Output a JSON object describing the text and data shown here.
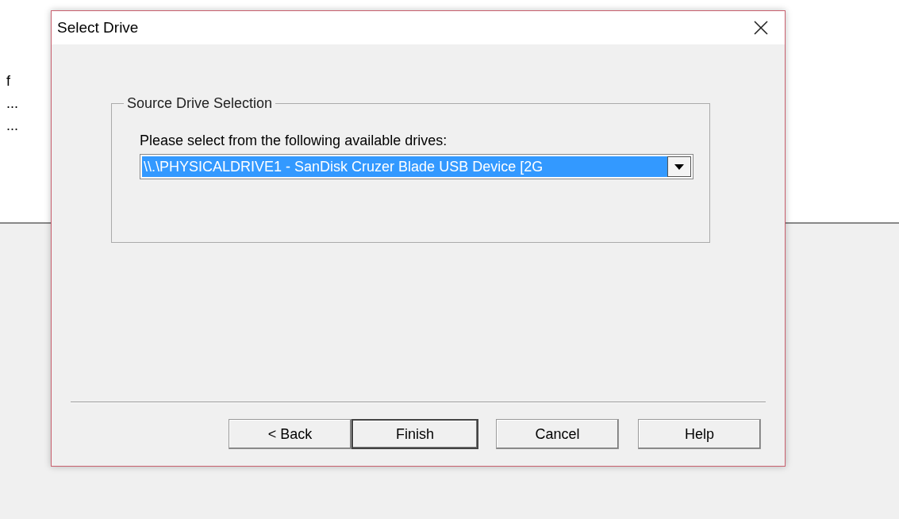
{
  "background": {
    "fragments": [
      "f",
      "...",
      "..."
    ]
  },
  "dialog": {
    "title": "Select Drive",
    "group": {
      "title": "Source Drive Selection",
      "prompt": "Please select from the following available drives:",
      "dropdown": {
        "value": "\\\\.\\PHYSICALDRIVE1 - SanDisk Cruzer Blade USB Device [2G",
        "highlighted": true
      }
    },
    "buttons": [
      {
        "label": "< Back",
        "default": false
      },
      {
        "label": "Finish",
        "default": true
      },
      {
        "label": "Cancel",
        "default": false
      },
      {
        "label": "Help",
        "default": false
      }
    ]
  }
}
